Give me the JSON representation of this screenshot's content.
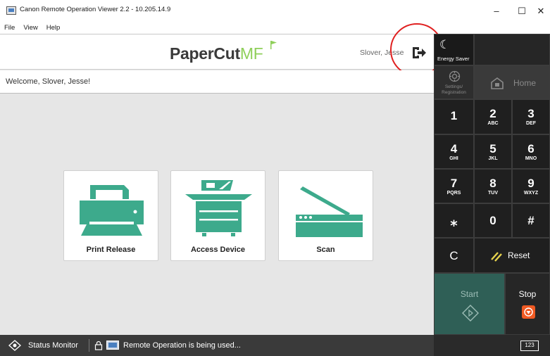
{
  "window": {
    "title": "Canon Remote Operation Viewer 2.2 - 10.205.14.9"
  },
  "menu": [
    "File",
    "View",
    "Help"
  ],
  "header": {
    "logo_main": "PaperCut",
    "logo_accent": "MF",
    "user": "Slover, Jesse"
  },
  "welcome": "Welcome, Slover, Jesse!",
  "tiles": [
    {
      "label": "Print Release",
      "icon": "printer-icon"
    },
    {
      "label": "Access Device",
      "icon": "copier-icon"
    },
    {
      "label": "Scan",
      "icon": "scanner-icon"
    }
  ],
  "keypad": {
    "energy_saver": "Energy Saver",
    "settings": "Settings/ Registration",
    "home": "Home",
    "keys": [
      {
        "digit": "1",
        "sub": ""
      },
      {
        "digit": "2",
        "sub": "ABC"
      },
      {
        "digit": "3",
        "sub": "DEF"
      },
      {
        "digit": "4",
        "sub": "GHI"
      },
      {
        "digit": "5",
        "sub": "JKL"
      },
      {
        "digit": "6",
        "sub": "MNO"
      },
      {
        "digit": "7",
        "sub": "PQRS"
      },
      {
        "digit": "8",
        "sub": "TUV"
      },
      {
        "digit": "9",
        "sub": "WXYZ"
      },
      {
        "digit": "⁎",
        "sub": ""
      },
      {
        "digit": "0",
        "sub": ""
      },
      {
        "digit": "#",
        "sub": ""
      }
    ],
    "clear": "C",
    "reset": "Reset",
    "start": "Start",
    "stop": "Stop"
  },
  "statusbar": {
    "status_monitor": "Status Monitor",
    "remote": "Remote Operation is being used...",
    "keyboard": "123"
  },
  "colors": {
    "accent_green": "#8fcf5a",
    "tile_icon": "#3daa8c",
    "start_bg": "#2f5f56",
    "stop_icon": "#f05a23",
    "highlight_circle": "#e02020"
  }
}
